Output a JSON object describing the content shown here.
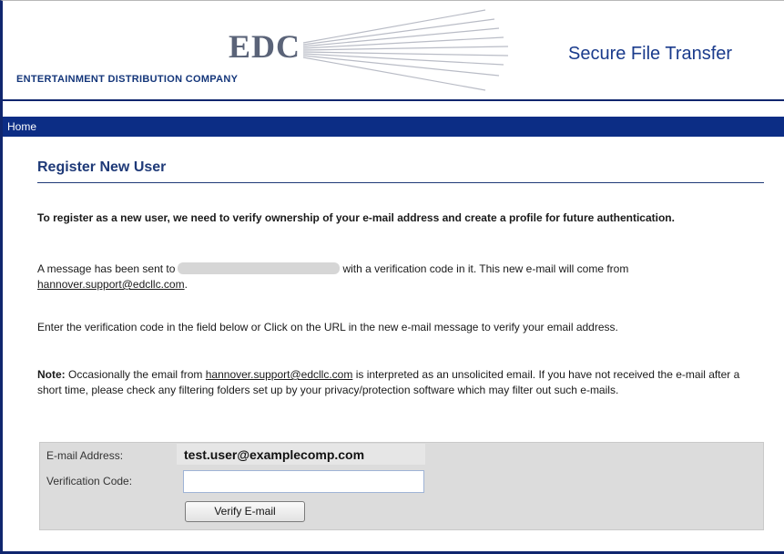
{
  "header": {
    "logo_mark": "EDC",
    "logo_subtitle": "ENTERTAINMENT DISTRIBUTION COMPANY",
    "site_title": "Secure File Transfer"
  },
  "nav": {
    "home_label": "Home"
  },
  "page": {
    "title": "Register New User",
    "intro": "To register as a new user, we need to verify ownership of your e-mail address and create a profile for future authentication.",
    "message_prefix": "A message has been sent to",
    "message_suffix": "with a verification code in it. This new e-mail will come from",
    "support_email": "hannover.support@edcllc.com",
    "period": ".",
    "instructions": "Enter the verification code in the field below or Click on the URL in the new e-mail message to verify your email address.",
    "note_label": "Note:",
    "note_prefix": "Occasionally the email from",
    "note_suffix": "is interpreted as an unsolicited email. If you have not received the e-mail after a short time, please check any filtering folders set up by your privacy/protection software which may filter out such e-mails."
  },
  "form": {
    "email_label": "E-mail Address:",
    "email_value": "test.user@examplecomp.com",
    "code_label": "Verification Code:",
    "code_value": "",
    "verify_button": "Verify E-mail"
  },
  "colors": {
    "brand_navy": "#0c2d85",
    "title_blue": "#1f3a78",
    "form_gray": "#dcdcdc"
  }
}
